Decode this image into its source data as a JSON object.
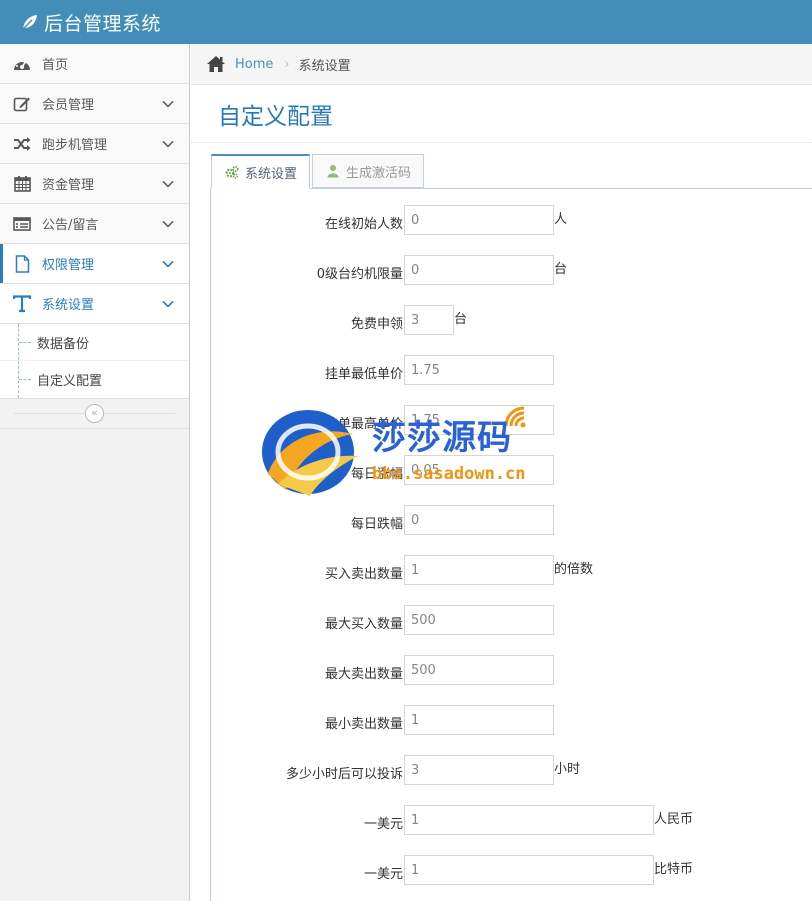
{
  "header": {
    "title": "后台管理系统"
  },
  "sidebar": {
    "items": [
      {
        "label": "首页",
        "icon": "dashboard-icon"
      },
      {
        "label": "会员管理",
        "icon": "edit-icon"
      },
      {
        "label": "跑步机管理",
        "icon": "shuffle-icon"
      },
      {
        "label": "资金管理",
        "icon": "calendar-icon"
      },
      {
        "label": "公告/留言",
        "icon": "list-icon"
      },
      {
        "label": "权限管理",
        "icon": "file-icon"
      },
      {
        "label": "系统设置",
        "icon": "text-icon"
      }
    ],
    "subitems": [
      {
        "label": "数据备份"
      },
      {
        "label": "自定义配置"
      }
    ],
    "collapse_label": "«"
  },
  "breadcrumb": {
    "home": "Home",
    "current": "系统设置"
  },
  "page": {
    "title": "自定义配置"
  },
  "tabs": [
    {
      "label": "系统设置",
      "icon": "cogs-icon",
      "active": true
    },
    {
      "label": "生成激活码",
      "icon": "user-icon",
      "active": false
    }
  ],
  "form": {
    "rows": [
      {
        "label": "在线初始人数",
        "value": "0",
        "unit": "人"
      },
      {
        "label": "0级台约机限量",
        "value": "0",
        "unit": "台"
      },
      {
        "label": "免费申领",
        "value": "3",
        "unit": "台"
      },
      {
        "label": "挂单最低单价",
        "value": "1.75",
        "unit": ""
      },
      {
        "label": "挂单最高单价",
        "value": "1.75",
        "unit": ""
      },
      {
        "label": "每日涨幅",
        "value": "0.05",
        "unit": ""
      },
      {
        "label": "每日跌幅",
        "value": "0",
        "unit": ""
      },
      {
        "label": "买入卖出数量",
        "value": "1",
        "unit": "的倍数"
      },
      {
        "label": "最大买入数量",
        "value": "500",
        "unit": ""
      },
      {
        "label": "最大卖出数量",
        "value": "500",
        "unit": ""
      },
      {
        "label": "最小卖出数量",
        "value": "1",
        "unit": ""
      },
      {
        "label": "多少小时后可以投诉",
        "value": "3",
        "unit": "小时"
      },
      {
        "label": "一美元",
        "value": "1",
        "unit": "人民币"
      },
      {
        "label": "一美元",
        "value": "1",
        "unit": "比特币"
      }
    ]
  },
  "watermark": {
    "text": "莎莎源码",
    "url": "bbs.sasadown.cn"
  },
  "colors": {
    "topbar": "#438eb9",
    "accent": "#2b7dbc",
    "page_title": "#2679b5"
  }
}
